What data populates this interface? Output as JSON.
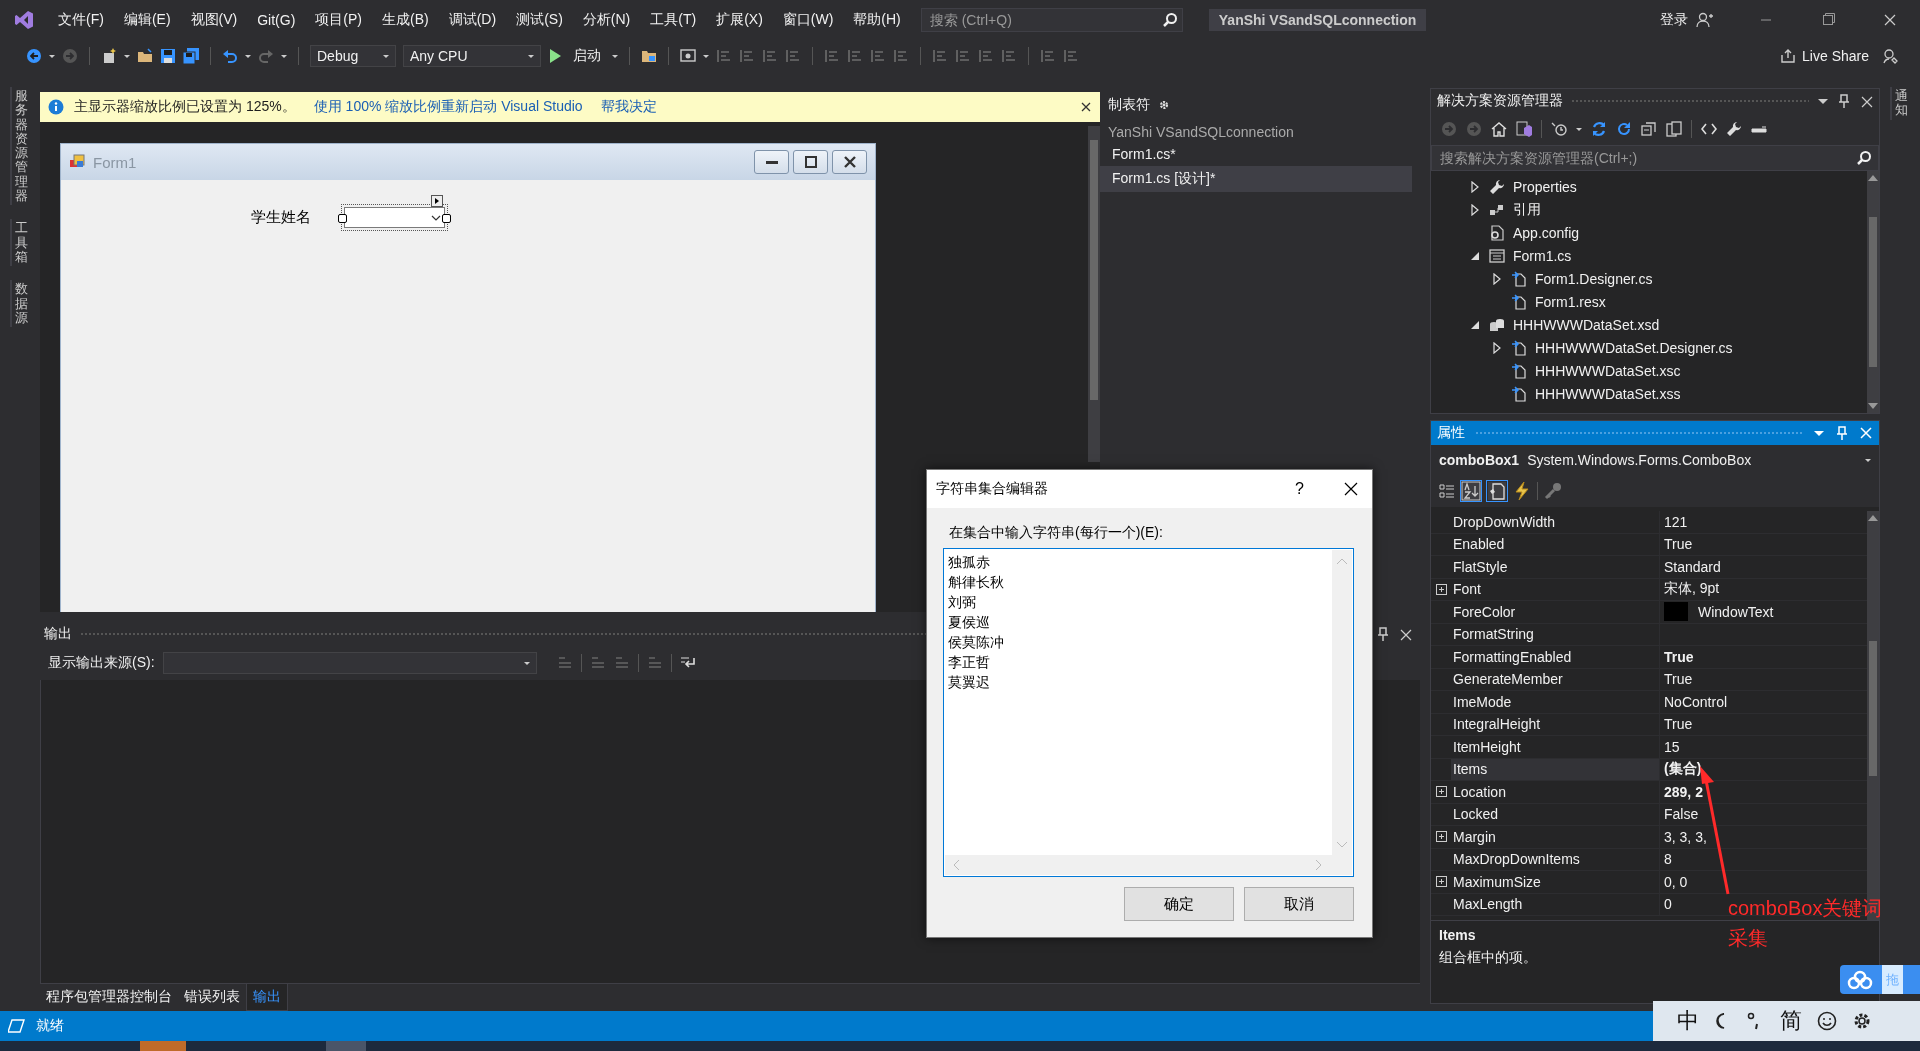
{
  "menu_bar": {
    "items": [
      "文件(F)",
      "编辑(E)",
      "视图(V)",
      "Git(G)",
      "项目(P)",
      "生成(B)",
      "调试(D)",
      "测试(S)",
      "分析(N)",
      "工具(T)",
      "扩展(X)",
      "窗口(W)",
      "帮助(H)"
    ],
    "search": {
      "placeholder": "搜索 (Ctrl+Q)"
    },
    "solution_name": "YanShi VSandSQLconnection",
    "login": "登录"
  },
  "toolbar": {
    "configuration": "Debug",
    "platform": "Any CPU",
    "start": "启动",
    "live_share": "Live Share"
  },
  "left_tabs": [
    "服务器资源管理器",
    "工具箱",
    "数据源"
  ],
  "right_tabs": [
    "通知"
  ],
  "info_bar": {
    "message": "主显示器缩放比例已设置为 125%。",
    "links": [
      "使用 100% 缩放比例重新启动 Visual Studio",
      "帮我决定"
    ]
  },
  "designer": {
    "form_title": "Form1",
    "label": "学生姓名"
  },
  "tab_panel": {
    "title": "制表符",
    "project": "YanShi VSandSQLconnection",
    "items": [
      {
        "label": "Form1.cs*",
        "selected": false
      },
      {
        "label": "Form1.cs [设计]*",
        "selected": true
      }
    ]
  },
  "solution_explorer": {
    "title": "解决方案资源管理器",
    "search": {
      "placeholder": "搜索解决方案资源管理器(Ctrl+;)"
    },
    "tree": [
      {
        "label": "Properties",
        "kind": "wrench",
        "expanded": false
      },
      {
        "label": "引用",
        "kind": "references",
        "expanded": false
      },
      {
        "label": "App.config",
        "kind": "config"
      },
      {
        "label": "Form1.cs",
        "kind": "form",
        "expanded": true,
        "children": [
          {
            "label": "Form1.Designer.cs",
            "kind": "file",
            "expanded": false
          },
          {
            "label": "Form1.resx",
            "kind": "file"
          }
        ]
      },
      {
        "label": "HHHWWWDataSet.xsd",
        "kind": "dataset",
        "expanded": true,
        "children": [
          {
            "label": "HHHWWWDataSet.Designer.cs",
            "kind": "file",
            "expanded": false
          },
          {
            "label": "HHHWWWDataSet.xsc",
            "kind": "file"
          },
          {
            "label": "HHHWWWDataSet.xss",
            "kind": "file"
          }
        ]
      }
    ]
  },
  "properties": {
    "title": "属性",
    "object": "comboBox1",
    "type": "System.Windows.Forms.ComboBox",
    "rows": [
      {
        "name": "DropDownWidth",
        "value": "121",
        "expandable": false,
        "bold": false,
        "selected": false
      },
      {
        "name": "Enabled",
        "value": "True",
        "expandable": false,
        "bold": false,
        "selected": false
      },
      {
        "name": "FlatStyle",
        "value": "Standard",
        "expandable": false,
        "bold": false,
        "selected": false
      },
      {
        "name": "Font",
        "value": "宋体, 9pt",
        "expandable": true,
        "bold": false,
        "selected": false
      },
      {
        "name": "ForeColor",
        "value": "WindowText",
        "color": "#000000",
        "expandable": false,
        "bold": false,
        "selected": false
      },
      {
        "name": "FormatString",
        "expandable": false,
        "bold": false,
        "selected": false
      },
      {
        "name": "FormattingEnabled",
        "value": "True",
        "expandable": false,
        "bold": true,
        "selected": false
      },
      {
        "name": "GenerateMember",
        "value": "True",
        "expandable": false,
        "bold": false,
        "selected": false
      },
      {
        "name": "ImeMode",
        "value": "NoControl",
        "expandable": false,
        "bold": false,
        "selected": false
      },
      {
        "name": "IntegralHeight",
        "value": "True",
        "expandable": false,
        "bold": false,
        "selected": false
      },
      {
        "name": "ItemHeight",
        "value": "15",
        "expandable": false,
        "bold": false,
        "selected": false
      },
      {
        "name": "Items",
        "value": "(集合)",
        "expandable": false,
        "bold": true,
        "selected": true
      },
      {
        "name": "Location",
        "value": "289, 2",
        "expandable": true,
        "bold": true,
        "selected": false
      },
      {
        "name": "Locked",
        "value": "False",
        "expandable": false,
        "bold": false,
        "selected": false
      },
      {
        "name": "Margin",
        "value": "3, 3, 3,",
        "expandable": true,
        "bold": false,
        "selected": false
      },
      {
        "name": "MaxDropDownItems",
        "value": "8",
        "expandable": false,
        "bold": false,
        "selected": false
      },
      {
        "name": "MaximumSize",
        "value": "0, 0",
        "expandable": true,
        "bold": false,
        "selected": false
      },
      {
        "name": "MaxLength",
        "value": "0",
        "expandable": false,
        "bold": false,
        "selected": false
      }
    ],
    "description": {
      "title": "Items",
      "text": "组合框中的项。"
    }
  },
  "output": {
    "title": "输出",
    "source_label": "显示输出来源(S):",
    "tabs": [
      {
        "label": "程序包管理器控制台",
        "selected": false
      },
      {
        "label": "错误列表",
        "selected": false
      },
      {
        "label": "输出",
        "selected": true
      }
    ]
  },
  "dialog": {
    "title": "字符串集合编辑器",
    "help": "?",
    "prompt": "在集合中输入字符串(每行一个)(E):",
    "lines": [
      "独孤赤",
      "斛律长秋",
      "刘弼",
      "夏侯巡",
      "侯莫陈冲",
      "李正哲",
      "莫翼迟"
    ],
    "buttons": [
      "确定",
      "取消"
    ]
  },
  "annotation": {
    "text": "comboBox关键词采集"
  },
  "status_bar": {
    "text": "就绪"
  },
  "ime_bar": {
    "items": [
      "中",
      "简"
    ]
  },
  "cloud_widget": {
    "text": "拖"
  }
}
